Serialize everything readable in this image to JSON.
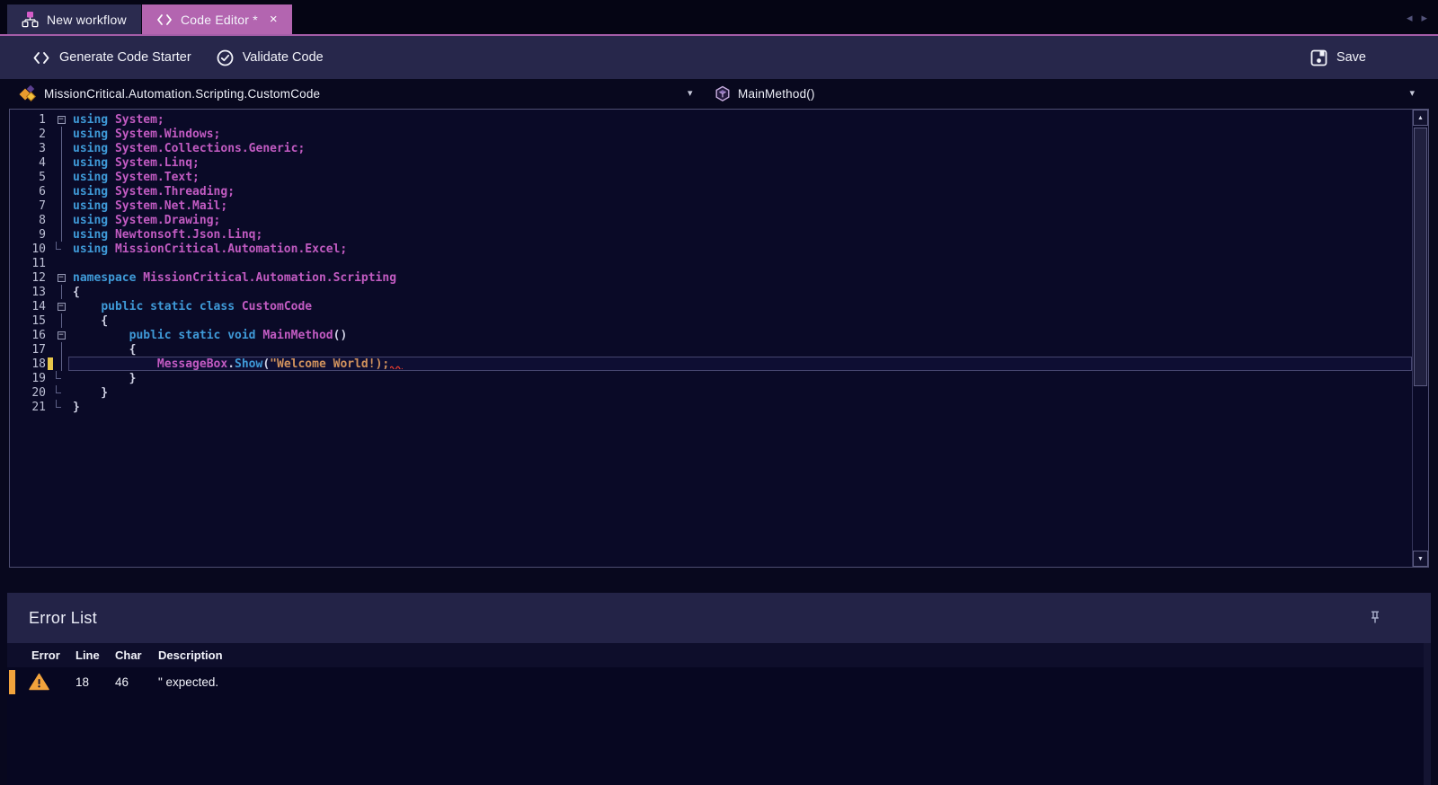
{
  "app": {
    "tab_bar": {
      "tabs": [
        {
          "label": "New workflow",
          "active": false
        },
        {
          "label": "Code Editor *",
          "active": true,
          "close": "×"
        }
      ],
      "nav_back": "◂",
      "nav_forward": "▸"
    },
    "toolbar": {
      "generate": "Generate Code Starter",
      "validate": "Validate Code",
      "save": "Save"
    },
    "selectors": {
      "class_path": "MissionCritical.Automation.Scripting.CustomCode",
      "method": "MainMethod()",
      "caret": "▾"
    },
    "scrollbar": {
      "up": "▲",
      "down": "▼"
    }
  },
  "editor": {
    "lines": [
      {
        "n": 1,
        "fold": "minus",
        "segs": [
          [
            "kw",
            "using "
          ],
          [
            "id",
            "System;"
          ]
        ]
      },
      {
        "n": 2,
        "fold": "vline",
        "segs": [
          [
            "kw",
            "using "
          ],
          [
            "id",
            "System.Windows;"
          ]
        ]
      },
      {
        "n": 3,
        "fold": "vline",
        "segs": [
          [
            "kw",
            "using "
          ],
          [
            "id",
            "System.Collections.Generic;"
          ]
        ]
      },
      {
        "n": 4,
        "fold": "vline",
        "segs": [
          [
            "kw",
            "using "
          ],
          [
            "id",
            "System.Linq;"
          ]
        ]
      },
      {
        "n": 5,
        "fold": "vline",
        "segs": [
          [
            "kw",
            "using "
          ],
          [
            "id",
            "System.Text;"
          ]
        ]
      },
      {
        "n": 6,
        "fold": "vline",
        "segs": [
          [
            "kw",
            "using "
          ],
          [
            "id",
            "System.Threading;"
          ]
        ]
      },
      {
        "n": 7,
        "fold": "vline",
        "segs": [
          [
            "kw",
            "using "
          ],
          [
            "id",
            "System.Net.Mail;"
          ]
        ]
      },
      {
        "n": 8,
        "fold": "vline",
        "segs": [
          [
            "kw",
            "using "
          ],
          [
            "id",
            "System.Drawing;"
          ]
        ]
      },
      {
        "n": 9,
        "fold": "vline",
        "segs": [
          [
            "kw",
            "using "
          ],
          [
            "id",
            "Newtonsoft.Json.Linq;"
          ]
        ]
      },
      {
        "n": 10,
        "fold": "corner",
        "segs": [
          [
            "kw",
            "using "
          ],
          [
            "id",
            "MissionCritical.Automation.Excel;"
          ]
        ]
      },
      {
        "n": 11,
        "fold": "none",
        "segs": []
      },
      {
        "n": 12,
        "fold": "minus",
        "segs": [
          [
            "kw",
            "namespace "
          ],
          [
            "id",
            "MissionCritical.Automation.Scripting"
          ]
        ]
      },
      {
        "n": 13,
        "fold": "vline",
        "segs": [
          [
            "pun",
            "{"
          ]
        ]
      },
      {
        "n": 14,
        "fold": "minus",
        "segs": [
          [
            "pun",
            "    "
          ],
          [
            "kw",
            "public static class "
          ],
          [
            "id",
            "CustomCode"
          ]
        ]
      },
      {
        "n": 15,
        "fold": "vline",
        "segs": [
          [
            "pun",
            "    {"
          ]
        ]
      },
      {
        "n": 16,
        "fold": "minus",
        "segs": [
          [
            "pun",
            "        "
          ],
          [
            "kw",
            "public static void "
          ],
          [
            "id",
            "MainMethod"
          ],
          [
            "pun",
            "()"
          ]
        ]
      },
      {
        "n": 17,
        "fold": "vline",
        "segs": [
          [
            "pun",
            "        {"
          ]
        ]
      },
      {
        "n": 18,
        "fold": "vline",
        "mark": true,
        "highlight": true,
        "squiggle": true,
        "segs": [
          [
            "pun",
            "            "
          ],
          [
            "id",
            "MessageBox"
          ],
          [
            "pun",
            "."
          ],
          [
            "kw",
            "Show"
          ],
          [
            "pun",
            "("
          ],
          [
            "str",
            "\"Welcome World!);"
          ]
        ]
      },
      {
        "n": 19,
        "fold": "corner",
        "segs": [
          [
            "pun",
            "        }"
          ]
        ]
      },
      {
        "n": 20,
        "fold": "corner",
        "segs": [
          [
            "pun",
            "    }"
          ]
        ]
      },
      {
        "n": 21,
        "fold": "corner",
        "segs": [
          [
            "pun",
            "}"
          ]
        ]
      }
    ]
  },
  "error_list": {
    "title": "Error List",
    "columns": [
      "Error",
      "Line",
      "Char",
      "Description"
    ],
    "rows": [
      {
        "severity": "warning",
        "line": "18",
        "char": "46",
        "description": "\" expected."
      }
    ]
  },
  "colors": {
    "accent_pink": "#b365b0",
    "keyword_blue": "#3f9ad8",
    "identifier_magenta": "#c25bc2",
    "string_orange": "#d1925d",
    "warning_orange": "#f2a33c",
    "error_red": "#e0392e"
  }
}
